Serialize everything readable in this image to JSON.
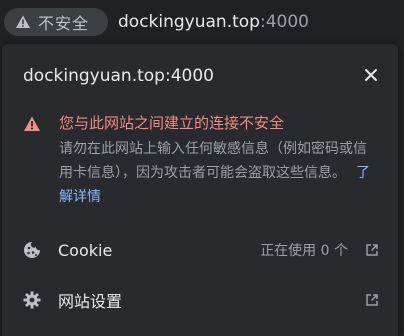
{
  "omnibox": {
    "security_chip_label": "不安全",
    "url_host": "dockingyuan.top",
    "url_port": ":4000",
    "warning_icon": "warning-triangle-icon"
  },
  "popup": {
    "title": "dockingyuan.top:4000",
    "close_icon": "close-icon",
    "warning": {
      "icon": "warning-triangle-icon",
      "heading": "您与此网站之间建立的连接不安全",
      "body": "请勿在此网站上输入任何敏感信息（例如密码或信用卡信息），因为攻击者可能会盗取这些信息。",
      "learn_more": "了解详情"
    },
    "rows": [
      {
        "icon": "cookie-icon",
        "label": "Cookie",
        "status": "正在使用 0 个",
        "action_icon": "open-external-icon"
      },
      {
        "icon": "gear-icon",
        "label": "网站设置",
        "status": "",
        "action_icon": "open-external-icon"
      }
    ]
  },
  "colors": {
    "background": "#202124",
    "popup_bg": "#292a2d",
    "warning_red": "#f28b82",
    "link_blue": "#8ab4f8",
    "text_primary": "#e8eaed",
    "text_secondary": "#9aa0a6"
  }
}
